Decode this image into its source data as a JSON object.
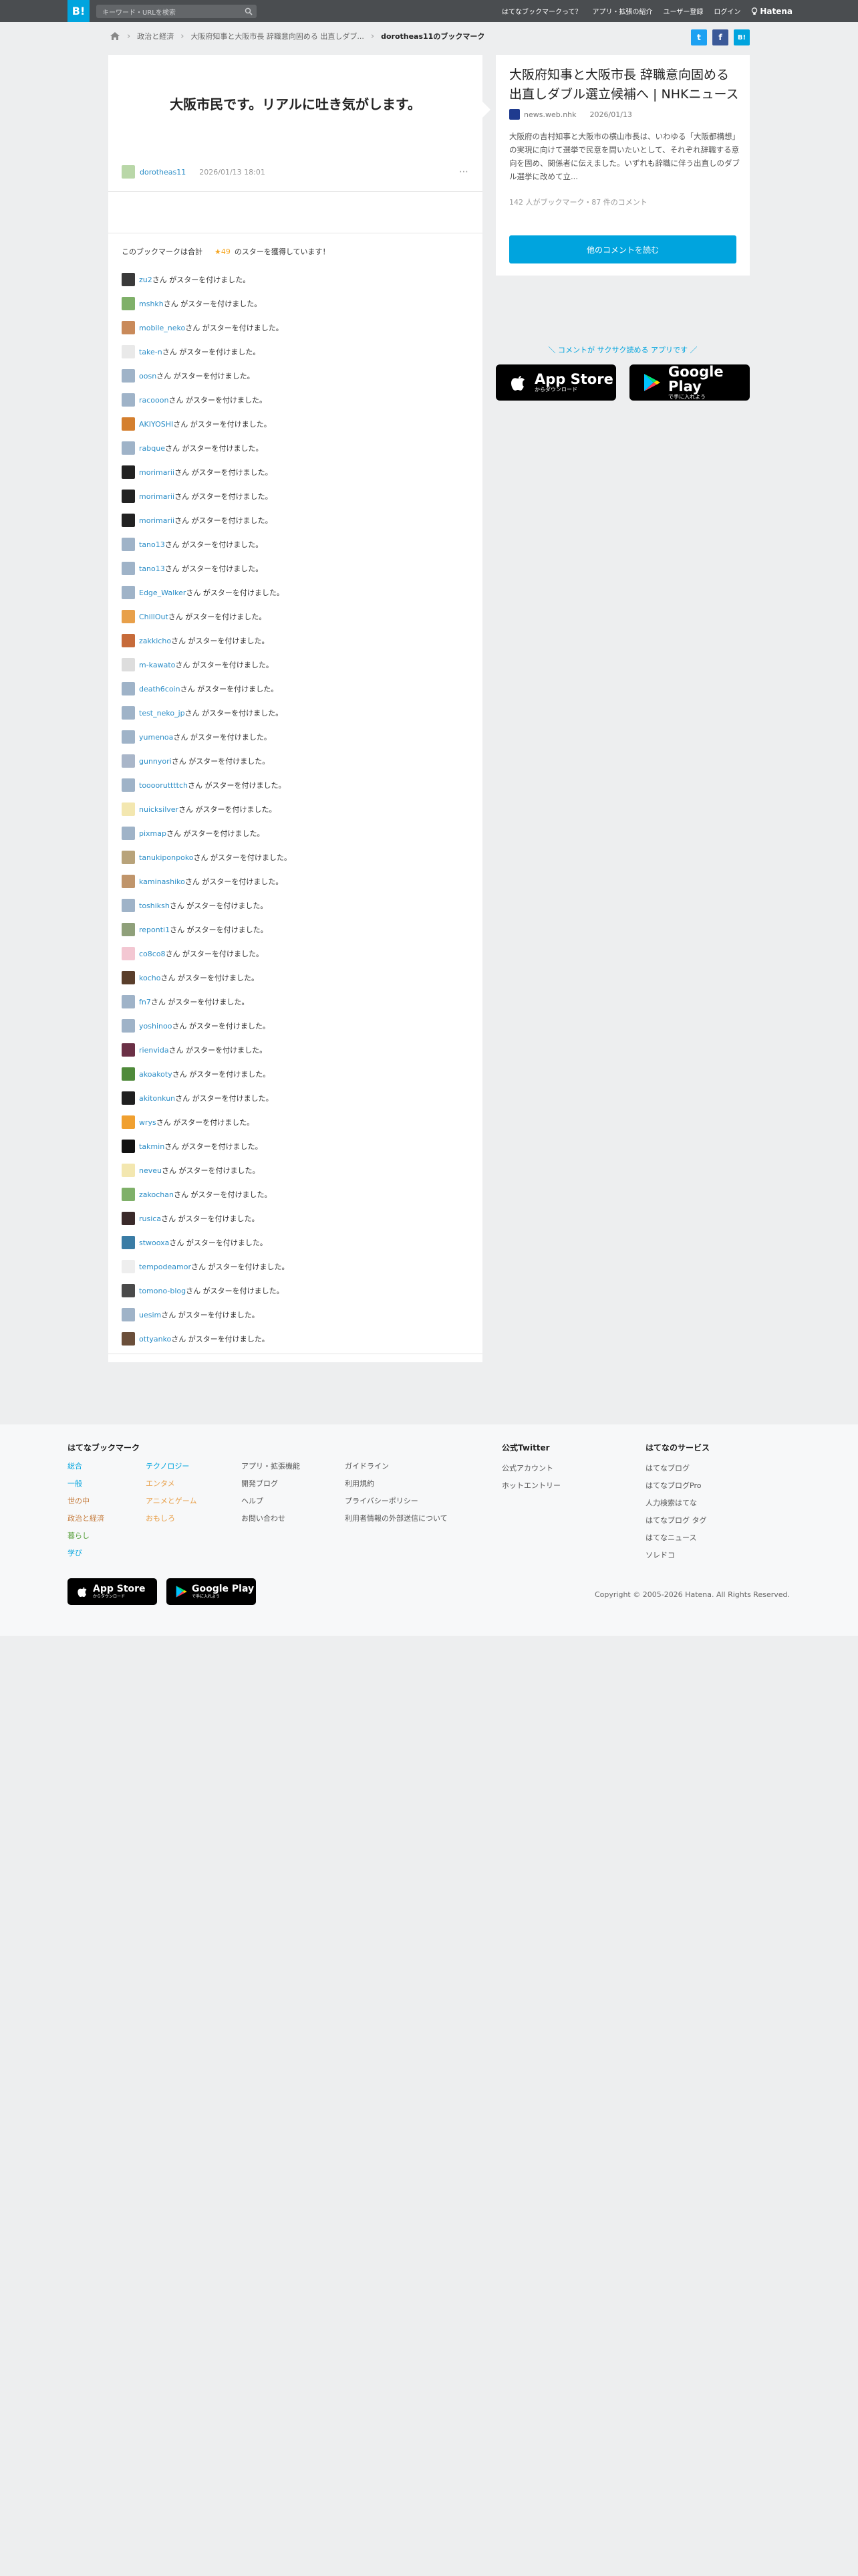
{
  "header": {
    "logo": "B!",
    "search_placeholder": "キーワード・URLを検索",
    "links": [
      "はてなブックマークって？",
      "アプリ・拡張の紹介",
      "ユーザー登録",
      "ログイン"
    ],
    "brand": "Hatena"
  },
  "breadcrumb": {
    "category": "政治と経済",
    "entry": "大阪府知事と大阪市長 辞職意向固める 出直しダブ...",
    "current": "dorotheas11のブックマーク"
  },
  "share": {
    "twitter": "t",
    "facebook": "f",
    "hatena": "B!"
  },
  "comment": {
    "text": "大阪市民です。リアルに吐き気がします。",
    "user": "dorotheas11",
    "date": "2026/01/13 18:01",
    "more": "⋯"
  },
  "stars": {
    "summary_prefix": "このブックマークは合計",
    "count": "★49",
    "summary_suffix": "のスターを獲得しています！",
    "suffix": "さん がスターを付けました。",
    "users": [
      {
        "name": "zu2",
        "color": "#3a3a3a"
      },
      {
        "name": "mshkh",
        "color": "#7fb069"
      },
      {
        "name": "mobile_neko",
        "color": "#c98a5a"
      },
      {
        "name": "take-n",
        "color": "#e9e9e9"
      },
      {
        "name": "oosn",
        "color": "#9fb3c8"
      },
      {
        "name": "racooon",
        "color": "#9fb3c8"
      },
      {
        "name": "AKIYOSHI",
        "color": "#d47f2e"
      },
      {
        "name": "rabque",
        "color": "#9fb3c8"
      },
      {
        "name": "morimarii",
        "color": "#222222"
      },
      {
        "name": "morimarii",
        "color": "#222222"
      },
      {
        "name": "morimarii",
        "color": "#222222"
      },
      {
        "name": "tano13",
        "color": "#9fb3c8"
      },
      {
        "name": "tano13",
        "color": "#9fb3c8"
      },
      {
        "name": "Edge_Walker",
        "color": "#9fb3c8"
      },
      {
        "name": "ChillOut",
        "color": "#e8a04a"
      },
      {
        "name": "zakkicho",
        "color": "#c76b3a"
      },
      {
        "name": "m-kawato",
        "color": "#dddddd"
      },
      {
        "name": "death6coin",
        "color": "#9fb3c8"
      },
      {
        "name": "test_neko_jp",
        "color": "#9fb3c8"
      },
      {
        "name": "yumenoa",
        "color": "#9fb3c8"
      },
      {
        "name": "gunnyori",
        "color": "#a9b6c9"
      },
      {
        "name": "tooooruttttch",
        "color": "#9fb3c8"
      },
      {
        "name": "nuicksilver",
        "color": "#f3e7b0"
      },
      {
        "name": "pixmap",
        "color": "#9fb3c8"
      },
      {
        "name": "tanukiponpoko",
        "color": "#b8a37a"
      },
      {
        "name": "kaminashiko",
        "color": "#c0956b"
      },
      {
        "name": "toshiksh",
        "color": "#9fb3c8"
      },
      {
        "name": "reponti1",
        "color": "#8fa07a"
      },
      {
        "name": "co8co8",
        "color": "#f3c7d2"
      },
      {
        "name": "kocho",
        "color": "#5a3e2b"
      },
      {
        "name": "fn7",
        "color": "#9fb3c8"
      },
      {
        "name": "yoshinoo",
        "color": "#9fb3c8"
      },
      {
        "name": "rienvida",
        "color": "#6b3046"
      },
      {
        "name": "akoakoty",
        "color": "#4f8a3a"
      },
      {
        "name": "akitonkun",
        "color": "#1f1f1f"
      },
      {
        "name": "wrys",
        "color": "#f0a030"
      },
      {
        "name": "takmin",
        "color": "#111111"
      },
      {
        "name": "neveu",
        "color": "#f3e7b0"
      },
      {
        "name": "zakochan",
        "color": "#7fb069"
      },
      {
        "name": "rusica",
        "color": "#3a2a2a"
      },
      {
        "name": "stwooxa",
        "color": "#3a7ca5"
      },
      {
        "name": "tempodeamor",
        "color": "#eeeeee"
      },
      {
        "name": "tomono-blog",
        "color": "#4a4a4a"
      },
      {
        "name": "uesim",
        "color": "#9fb3c8"
      },
      {
        "name": "ottyanko",
        "color": "#6b4f3a"
      }
    ]
  },
  "entry": {
    "title": "大阪府知事と大阪市長 辞職意向固める 出直しダブル選立候補へ | NHKニュース",
    "source": "news.web.nhk",
    "date": "2026/01/13",
    "description": "大阪府の吉村知事と大阪市の横山市長は、いわゆる「大阪都構想」の実現に向けて選挙で民意を問いたいとして、それぞれ辞職する意向を固め、関係者に伝えました。いずれも辞職に伴う出直しのダブル選挙に改めて立...",
    "stats": "142 人がブックマーク・87 件のコメント",
    "button": "他のコメントを読む"
  },
  "promo": {
    "text": "＼ コメントが サクサク読める アプリです ／",
    "appstore_big": "App Store",
    "appstore_small": "からダウンロード",
    "gplay_big": "Google Play",
    "gplay_small": "で手に入れよう"
  },
  "footer": {
    "title": "はてなブックマーク",
    "categories_col1": [
      "総合",
      "一般",
      "世の中",
      "政治と経済",
      "暮らし",
      "学び"
    ],
    "categories_col1_colors": [
      "#00a4de",
      "#00a4de",
      "#c57b3c",
      "#c57b3c",
      "#58a03c",
      "#00a4de"
    ],
    "categories_col2": [
      "テクノロジー",
      "エンタメ",
      "アニメとゲーム",
      "おもしろ"
    ],
    "categories_col2_colors": [
      "#00a4de",
      "#e8a04a",
      "#e8a04a",
      "#e8a04a"
    ],
    "links_col3": [
      "アプリ・拡張機能",
      "開発ブログ",
      "ヘルプ",
      "お問い合わせ"
    ],
    "links_col4": [
      "ガイドライン",
      "利用規約",
      "プライバシーポリシー",
      "利用者情報の外部送信について"
    ],
    "twitter_title": "公式Twitter",
    "twitter_links": [
      "公式アカウント",
      "ホットエントリー"
    ],
    "services_title": "はてなのサービス",
    "services": [
      "はてなブログ",
      "はてなブログPro",
      "人力検索はてな",
      "はてなブログ タグ",
      "はてなニュース",
      "ソレドコ"
    ],
    "copyright": "Copyright © 2005-2026 Hatena. All Rights Reserved.",
    "appstore_big": "App Store",
    "appstore_small": "からダウンロード",
    "gplay_big": "Google Play",
    "gplay_small": "で手に入れよう"
  },
  "colors": {
    "accent": "#00a4de",
    "header": "#4a4d50",
    "link": "#2a8dc7",
    "star": "#f5a623"
  }
}
